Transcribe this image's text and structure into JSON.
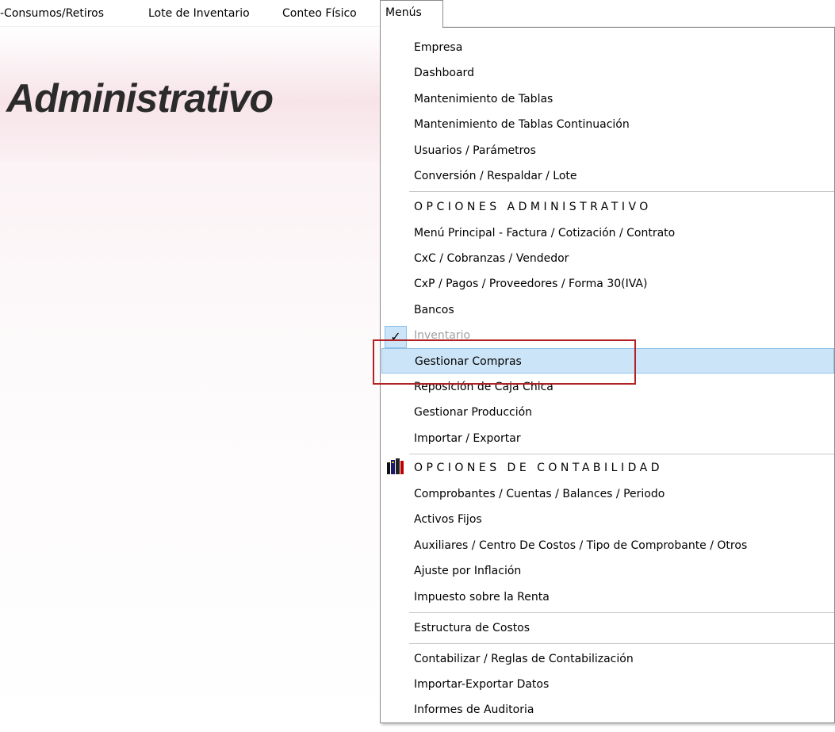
{
  "menubar": {
    "items": [
      "-Consumos/Retiros",
      "Lote de Inventario",
      "Conteo Físico",
      "Menús"
    ]
  },
  "brand": {
    "title": "Administrativo"
  },
  "dropdown": {
    "items": [
      "Empresa",
      "Dashboard",
      "Mantenimiento de Tablas",
      "Mantenimiento de Tablas Continuación",
      "Usuarios / Parámetros",
      "Conversión / Respaldar / Lote",
      "OPCIONES ADMINISTRATIVO",
      "Menú Principal - Factura / Cotización / Contrato",
      "CxC / Cobranzas / Vendedor",
      "CxP / Pagos / Proveedores / Forma 30(IVA)",
      "Bancos",
      "Inventario",
      "Gestionar Compras",
      "Reposición de Caja Chica",
      "Gestionar Producción",
      "Importar / Exportar",
      "OPCIONES DE CONTABILIDAD",
      "Comprobantes / Cuentas / Balances / Periodo",
      "Activos Fijos",
      "Auxiliares / Centro De Costos / Tipo de Comprobante / Otros",
      "Ajuste por Inflación",
      "Impuesto sobre la Renta",
      "Estructura de Costos",
      "Contabilizar / Reglas de Contabilización",
      "Importar-Exportar Datos",
      "Informes de Auditoria"
    ],
    "checked_item": "Inventario",
    "highlighted_item": "Gestionar Compras"
  },
  "colors": {
    "highlight": "#cce4f7",
    "annotation_box": "#b22222"
  },
  "icons": {
    "check": "checkmark-icon",
    "contabilidad": "books-icon"
  }
}
